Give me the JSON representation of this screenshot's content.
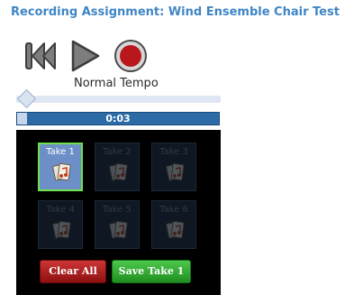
{
  "header": {
    "title": "Recording Assignment: Wind Ensemble Chair Test"
  },
  "controls": {
    "rewind_icon": "rewind-icon",
    "play_icon": "play-icon",
    "record_icon": "record-icon",
    "record_color": "#b8171c"
  },
  "tempo": {
    "label": "Normal Tempo",
    "value": 0.03
  },
  "progress": {
    "time": "0:03",
    "fraction": 0.05
  },
  "takes": [
    {
      "label": "Take 1",
      "active": true
    },
    {
      "label": "Take 2",
      "active": false
    },
    {
      "label": "Take 3",
      "active": false
    },
    {
      "label": "Take 4",
      "active": false
    },
    {
      "label": "Take 5",
      "active": false
    },
    {
      "label": "Take 6",
      "active": false
    }
  ],
  "actions": {
    "clear_label": "Clear All",
    "save_label": "Save Take 1"
  }
}
